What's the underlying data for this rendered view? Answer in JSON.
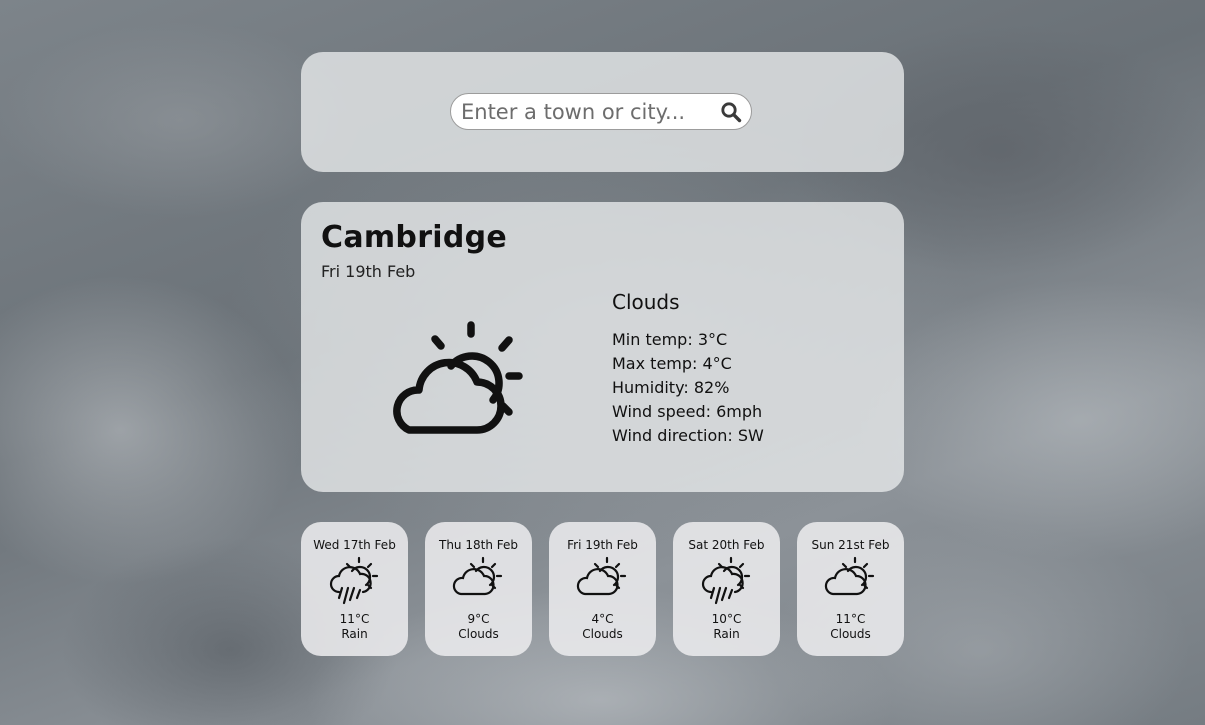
{
  "search": {
    "placeholder": "Enter a town or city...",
    "value": "",
    "button_icon": "search-icon"
  },
  "current": {
    "city": "Cambridge",
    "date": "Fri 19th Feb",
    "icon": "partly-cloudy-icon",
    "condition": "Clouds",
    "min_temp": "Min temp: 3°C",
    "max_temp": "Max temp: 4°C",
    "humidity": "Humidity: 82%",
    "wind_speed": "Wind speed: 6mph",
    "wind_direction": "Wind direction: SW"
  },
  "forecast": [
    {
      "date": "Wed 17th Feb",
      "icon": "rain-icon",
      "temp": "11°C",
      "condition": "Rain"
    },
    {
      "date": "Thu 18th Feb",
      "icon": "partly-cloudy-icon",
      "temp": "9°C",
      "condition": "Clouds"
    },
    {
      "date": "Fri 19th Feb",
      "icon": "partly-cloudy-icon",
      "temp": "4°C",
      "condition": "Clouds"
    },
    {
      "date": "Sat 20th Feb",
      "icon": "rain-icon",
      "temp": "10°C",
      "condition": "Rain"
    },
    {
      "date": "Sun 21st Feb",
      "icon": "partly-cloudy-icon",
      "temp": "11°C",
      "condition": "Clouds"
    }
  ]
}
